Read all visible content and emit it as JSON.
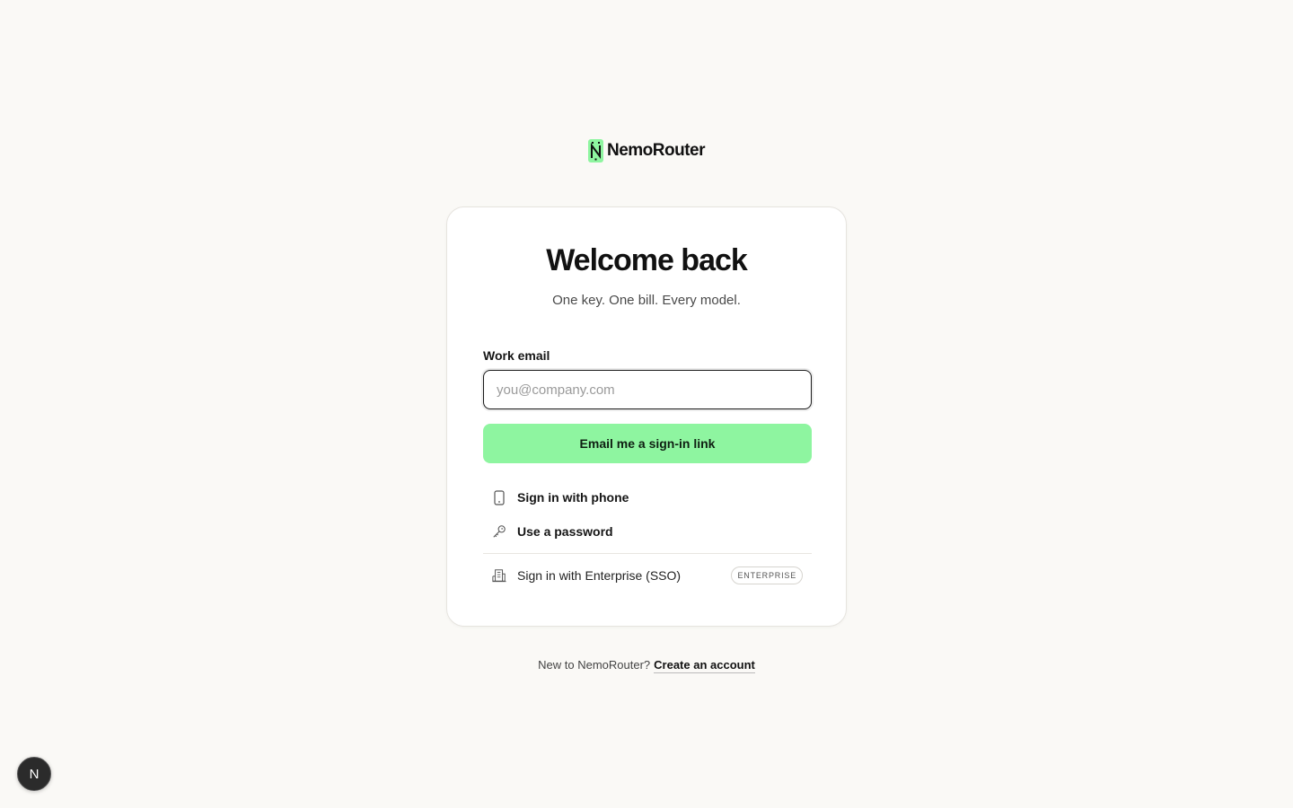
{
  "brand": {
    "name": "NemoRouter",
    "mark_color": "#8ef5a0"
  },
  "card": {
    "title": "Welcome back",
    "subtitle": "One key. One bill. Every model.",
    "email_label": "Work email",
    "email_value": "",
    "email_placeholder": "you@company.com",
    "primary_button": "Email me a sign-in link",
    "options": {
      "phone": {
        "label": "Sign in with phone",
        "icon": "phone-icon"
      },
      "password": {
        "label": "Use a password",
        "icon": "key-icon"
      },
      "sso": {
        "label": "Sign in with Enterprise (SSO)",
        "icon": "building-icon",
        "badge": "ENTERPRISE"
      }
    }
  },
  "footer": {
    "prompt": "New to NemoRouter?",
    "link": "Create an account"
  },
  "dev_badge": {
    "letter": "N"
  },
  "colors": {
    "accent": "#8ef5a0",
    "background": "#faf9f6",
    "text": "#151515"
  }
}
